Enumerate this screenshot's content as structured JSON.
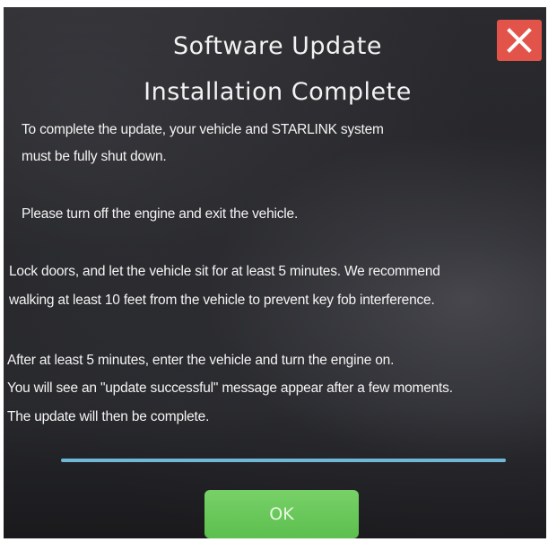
{
  "dialog": {
    "title_line1": "Software Update",
    "title_line2": "Installation Complete",
    "close_icon": "close-x-icon",
    "paragraphs": [
      "To complete the update, your vehicle and STARLINK system",
      "must be fully shut down.",
      "Please turn off the engine and exit the vehicle.",
      "Lock doors, and let the vehicle sit for at least 5 minutes. We recommend",
      "walking at least 10 feet from the vehicle to prevent key fob interference.",
      "After at least 5 minutes, enter the vehicle and turn the engine on.",
      "You will see an \"update successful\" message appear after a few moments.",
      "The update will then be complete."
    ],
    "ok_label": "OK"
  },
  "colors": {
    "close_button": "#e2544a",
    "ok_button": "#5cbf4e",
    "divider": "#6fb6d9",
    "background": "#222326",
    "text": "#f4f4f4"
  }
}
